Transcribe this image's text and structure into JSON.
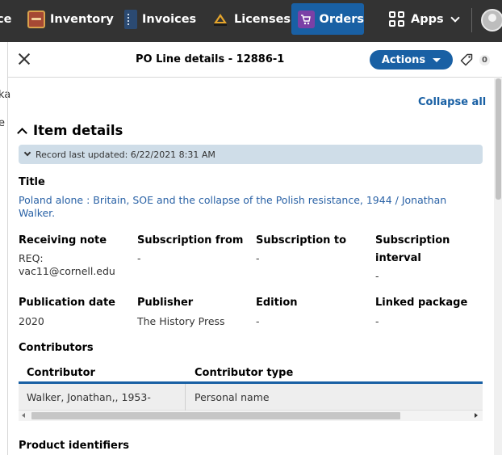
{
  "topbar": {
    "apps": [
      {
        "label": "ce",
        "icon": "truncated-app"
      },
      {
        "label": "Inventory",
        "icon": "inventory-icon"
      },
      {
        "label": "Invoices",
        "icon": "invoices-icon"
      },
      {
        "label": "Licenses",
        "icon": "licenses-icon"
      },
      {
        "label": "Orders",
        "icon": "orders-icon",
        "active": true
      }
    ],
    "apps_menu_label": "Apps",
    "accent": "#1960a4",
    "bar_color": "#333333"
  },
  "left_pane": {
    "sliver_chars": [
      "ka",
      "e"
    ]
  },
  "pane": {
    "title": "PO Line details - 12886-1",
    "actions_label": "Actions",
    "tag_count": "0"
  },
  "content": {
    "collapse_all": "Collapse all",
    "section_title": "Item details",
    "record_updated": "Record last updated: 6/22/2021 8:31 AM",
    "title_label": "Title",
    "title_value": "Poland alone : Britain, SOE and the collapse of the Polish resistance, 1944 / Jonathan Walker.",
    "fields_row1": [
      {
        "label": "Receiving note",
        "value": "REQ: vac11@cornell.edu"
      },
      {
        "label": "Subscription from",
        "value": "-"
      },
      {
        "label": "Subscription to",
        "value": "-"
      },
      {
        "label": "Subscription interval",
        "value": "-"
      }
    ],
    "fields_row2": [
      {
        "label": "Publication date",
        "value": "2020"
      },
      {
        "label": "Publisher",
        "value": "The History Press"
      },
      {
        "label": "Edition",
        "value": "-"
      },
      {
        "label": "Linked package",
        "value": "-"
      }
    ],
    "contributors_label": "Contributors",
    "contributors_table": {
      "columns": [
        "Contributor",
        "Contributor type"
      ],
      "rows": [
        [
          "Walker, Jonathan,, 1953-",
          "Personal name"
        ]
      ]
    },
    "product_identifiers_label": "Product identifiers"
  }
}
